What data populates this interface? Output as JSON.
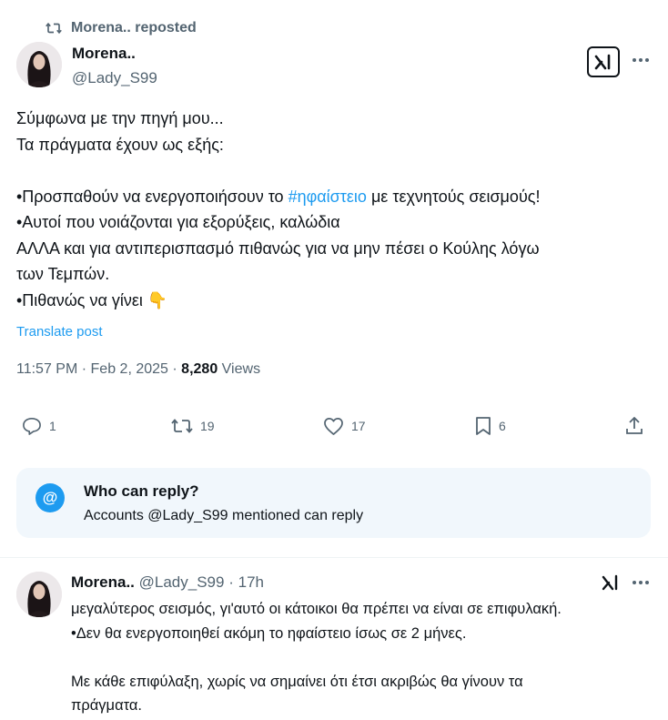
{
  "repost": {
    "label": "Morena.. reposted"
  },
  "post": {
    "author_name": "Morena..",
    "author_handle": "@Lady_S99",
    "body": {
      "line1": "Σύμφωνα με την πηγή μου...",
      "line2": "Τα πράγματα έχουν ως εξής:",
      "line3_prefix": "•Προσπαθούν να ενεργοποιήσουν το ",
      "hashtag": "#ηφαίστειο",
      "line3_suffix": " με τεχνητούς σεισμούς!",
      "line4": "•Αυτοί που νοιάζονται για εξορύξεις, καλώδια",
      "line5": "ΑΛΛΑ και για αντιπερισπασμό πιθανώς για να μην πέσει ο Κούλης λόγω",
      "line6": "των Τεμπών.",
      "line7_prefix": "•Πιθανώς να γίνει ",
      "emoji": "👇"
    },
    "translate_label": "Translate post",
    "time": "11:57 PM",
    "date": "Feb 2, 2025",
    "views_count": "8,280",
    "views_label": "Views",
    "replies": "1",
    "reposts": "19",
    "likes": "17",
    "bookmarks": "6"
  },
  "reply_restriction": {
    "icon": "@",
    "title": "Who can reply?",
    "subtitle": "Accounts @Lady_S99 mentioned can reply"
  },
  "reply": {
    "author_name": "Morena..",
    "author_handle": "@Lady_S99",
    "time_ago": "17h",
    "line1": "μεγαλύτερος σεισμός, γι'αυτό οι κάτοικοι θα πρέπει να είναι σε επιφυλακή.",
    "line2": "•Δεν θα ενεργοποιηθεί ακόμη το ηφαίστειο ίσως σε 2 μήνες.",
    "line3": "Με κάθε επιφύλαξη, χωρίς να σημαίνει ότι έτσι ακριβώς θα γίνουν τα",
    "line4": "πράγματα."
  },
  "icons": {
    "repost": "repost-icon",
    "grok": "grok-icon",
    "more": "more-icon",
    "reply": "reply-icon",
    "like": "like-icon",
    "bookmark": "bookmark-icon",
    "share": "share-icon"
  },
  "colors": {
    "accent": "#1d9bf0",
    "muted": "#536471",
    "text": "#0f1419",
    "reply_box_bg": "#f1f7fc"
  }
}
